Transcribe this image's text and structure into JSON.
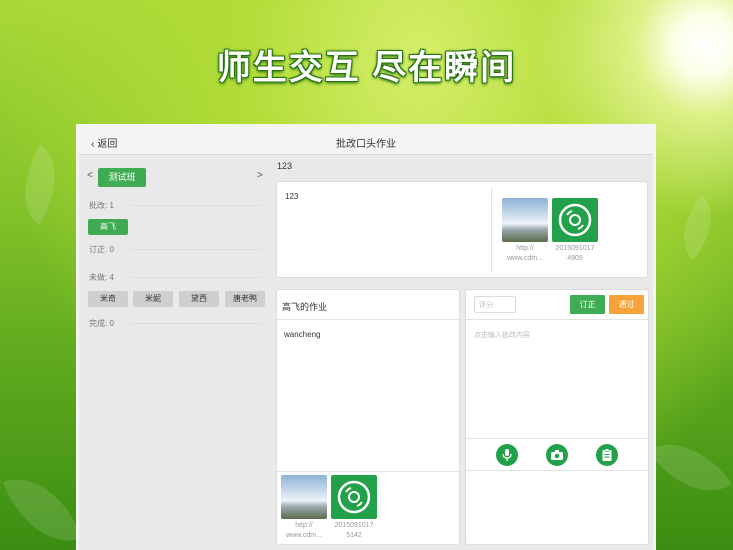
{
  "headline": "师生交互  尽在瞬间",
  "nav": {
    "back_label": "返回",
    "title": "批改口头作业"
  },
  "class_selector": {
    "prev": "<",
    "next": ">",
    "class_name": "测试班"
  },
  "status": {
    "corrected_label": "批改: 1",
    "corrected_students": [
      "高飞"
    ],
    "revise_label": "订正: 0",
    "undone_label": "未做: 4",
    "undone_students": [
      "米奇",
      "米妮",
      "黛西",
      "唐老鸭"
    ],
    "done_label": "完成: 0"
  },
  "question": {
    "heading": "123",
    "text": "123",
    "attachments": [
      {
        "type": "image",
        "caption1": "http://",
        "caption2": "www.cdm..."
      },
      {
        "type": "audio",
        "caption1": "2015091017",
        "caption2": "4905"
      }
    ]
  },
  "work": {
    "title": "高飞的作业",
    "content": "wancheng",
    "attachments": [
      {
        "type": "image",
        "caption1": "http://",
        "caption2": "www.cdm..."
      },
      {
        "type": "audio",
        "caption1": "2015091017",
        "caption2": "5142"
      }
    ]
  },
  "review": {
    "score_placeholder": "评分",
    "revise_button": "订正",
    "pass_button": "通过",
    "comment_placeholder": "点击输入批改内容",
    "tools": [
      "microphone-icon",
      "camera-icon",
      "clipboard-icon"
    ]
  },
  "colors": {
    "accent_green": "#3fac54",
    "attachment_green": "#22a04a",
    "pass_orange": "#f7a23b"
  }
}
